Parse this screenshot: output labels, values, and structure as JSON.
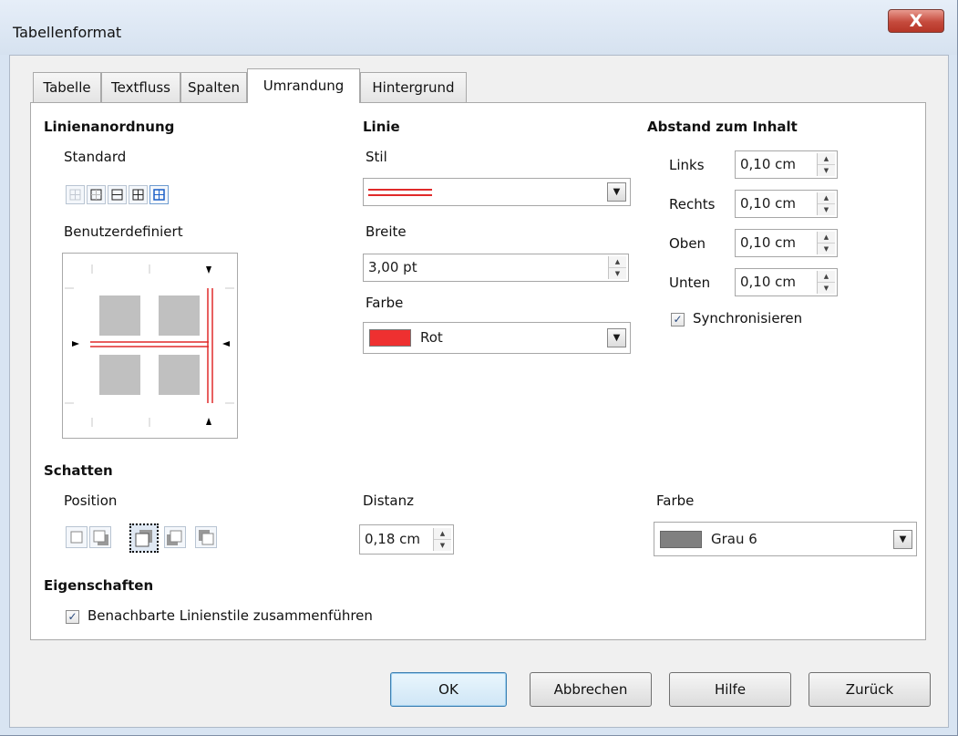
{
  "dialog": {
    "title": "Tabellenformat",
    "close_glyph": "X"
  },
  "tabs": [
    {
      "label": "Tabelle"
    },
    {
      "label": "Textfluss"
    },
    {
      "label": "Spalten"
    },
    {
      "label": "Umrandung",
      "active": true
    },
    {
      "label": "Hintergrund"
    }
  ],
  "linienanordnung": {
    "heading": "Linienanordnung",
    "standard_label": "Standard",
    "benutzerdefiniert_label": "Benutzerdefiniert"
  },
  "linie": {
    "heading": "Linie",
    "stil_label": "Stil",
    "breite_label": "Breite",
    "breite_value": "3,00 pt",
    "farbe_label": "Farbe",
    "farbe_value": "Rot",
    "farbe_color": "#ee3030"
  },
  "abstand": {
    "heading": "Abstand zum Inhalt",
    "links_label": "Links",
    "links_value": "0,10 cm",
    "rechts_label": "Rechts",
    "rechts_value": "0,10 cm",
    "oben_label": "Oben",
    "oben_value": "0,10 cm",
    "unten_label": "Unten",
    "unten_value": "0,10 cm",
    "sync_label": "Synchronisieren",
    "sync_checked": true
  },
  "schatten": {
    "heading": "Schatten",
    "position_label": "Position",
    "distanz_label": "Distanz",
    "distanz_value": "0,18 cm",
    "farbe_label": "Farbe",
    "farbe_value": "Grau 6",
    "farbe_color": "#808080"
  },
  "eigenschaften": {
    "heading": "Eigenschaften",
    "merge_label": "Benachbarte Linienstile zusammenführen",
    "merge_checked": true
  },
  "buttons": {
    "ok": "OK",
    "cancel": "Abbrechen",
    "help": "Hilfe",
    "reset": "Zurück"
  },
  "colors": {
    "border_line_red": "#e02a2a"
  }
}
